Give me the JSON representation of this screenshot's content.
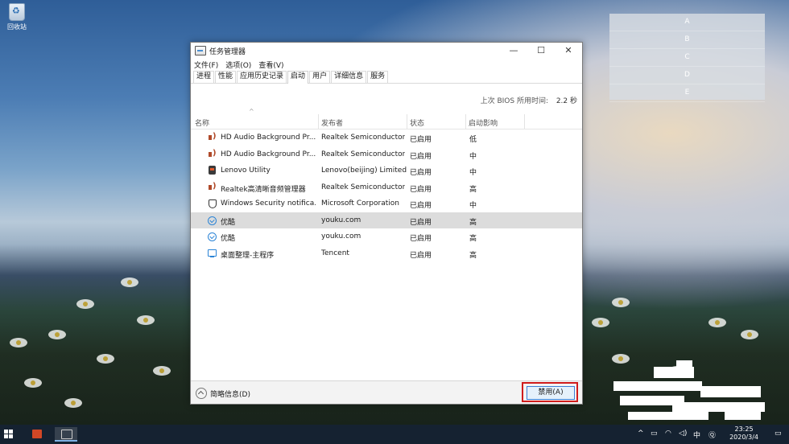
{
  "desktop": {
    "recycle_bin_label": "回收站"
  },
  "side_panel": {
    "items": [
      "A",
      "B",
      "C",
      "D",
      "E"
    ]
  },
  "window": {
    "title": "任务管理器",
    "controls": {
      "minimize": "—",
      "maximize": "☐",
      "close": "✕"
    },
    "menu": [
      "文件(F)",
      "选项(O)",
      "查看(V)"
    ],
    "tabs": [
      "进程",
      "性能",
      "应用历史记录",
      "启动",
      "用户",
      "详细信息",
      "服务"
    ],
    "active_tab": "启动",
    "bios_label": "上次 BIOS 所用时间:",
    "bios_value": "2.2 秒",
    "columns": {
      "name": "名称",
      "publisher": "发布者",
      "status": "状态",
      "impact": "启动影响"
    },
    "rows": [
      {
        "icon": "speaker-icon",
        "name": "HD Audio Background Pr...",
        "publisher": "Realtek Semiconductor",
        "status": "已启用",
        "impact": "低"
      },
      {
        "icon": "speaker-icon",
        "name": "HD Audio Background Pr...",
        "publisher": "Realtek Semiconductor",
        "status": "已启用",
        "impact": "中"
      },
      {
        "icon": "lenovo-icon",
        "name": "Lenovo Utility",
        "publisher": "Lenovo(beijing) Limited",
        "status": "已启用",
        "impact": "中"
      },
      {
        "icon": "speaker-icon",
        "name": "Realtek高清晰音频管理器",
        "publisher": "Realtek Semiconductor",
        "status": "已启用",
        "impact": "高"
      },
      {
        "icon": "shield-icon",
        "name": "Windows Security notifica...",
        "publisher": "Microsoft Corporation",
        "status": "已启用",
        "impact": "中"
      },
      {
        "icon": "youku-icon",
        "name": "优酷",
        "publisher": "youku.com",
        "status": "已启用",
        "impact": "高"
      },
      {
        "icon": "youku-icon",
        "name": "优酷",
        "publisher": "youku.com",
        "status": "已启用",
        "impact": "高"
      },
      {
        "icon": "monitor-icon",
        "name": "桌面整理-主程序",
        "publisher": "Tencent",
        "status": "已启用",
        "impact": "高"
      }
    ],
    "selected_row": 5,
    "fewer_details_label": "简略信息(D)",
    "disable_button_label": "禁用(A)"
  },
  "taskbar": {
    "tray_chinese": "中",
    "clock_time": "23:25",
    "clock_date": "2020/3/4"
  },
  "colors": {
    "highlight_border": "#d01c1c",
    "button_accent": "#3d7fd6",
    "selected_row": "#dcdcdc"
  }
}
